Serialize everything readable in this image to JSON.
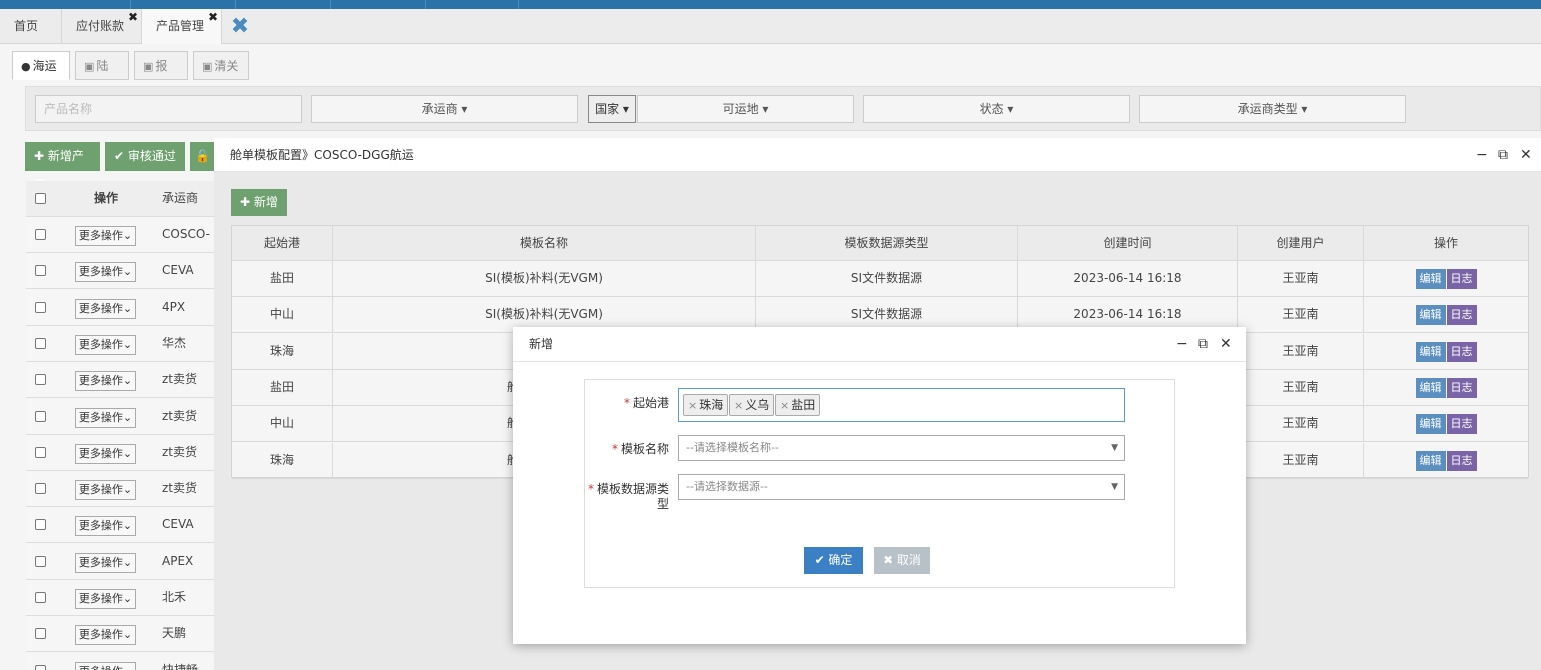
{
  "tabs": [
    {
      "label": "首页",
      "closable": false
    },
    {
      "label": "应付账款",
      "closable": true
    },
    {
      "label": "产品管理",
      "closable": true
    }
  ],
  "subtabs": [
    {
      "label": "海运",
      "icon": "user-icon"
    },
    {
      "label": "陆运",
      "icon": "truck-icon"
    },
    {
      "label": "报关",
      "icon": "truck-icon"
    },
    {
      "label": "清关",
      "icon": "truck-icon"
    }
  ],
  "filters": {
    "product_name_placeholder": "产品名称",
    "carrier": "承运商 ▾",
    "country": "国家 ▾",
    "destination": "可运地 ▾",
    "status": "状态 ▾",
    "carrier_type": "承运商类型 ▾"
  },
  "actions": {
    "add_product": "✚ 新增产品",
    "approve": "✔ 审核通过",
    "unlock": "🔓"
  },
  "left_table": {
    "headers": [
      "操作",
      "承运商"
    ],
    "more_label": "更多操作⌄",
    "carriers": [
      "COSCO-DC",
      "CEVA",
      "4PX",
      "华杰",
      "zt卖货",
      "zt卖货",
      "zt卖货",
      "zt卖货",
      "CEVA",
      "APEX",
      "北禾",
      "天鹏",
      "快捷畅"
    ]
  },
  "dialog1": {
    "title": "舱单模板配置》COSCO-DGG航运",
    "new_label": "✚ 新增",
    "headers": [
      "起始港",
      "模板名称",
      "模板数据源类型",
      "创建时间",
      "创建用户",
      "操作"
    ],
    "edit_label": "编辑",
    "log_label": "日志",
    "rows": [
      {
        "port": "盐田",
        "template": "SI(模板)补料(无VGM)",
        "source": "SI文件数据源",
        "created": "2023-06-14 16:18",
        "user": "王亚南"
      },
      {
        "port": "中山",
        "template": "SI(模板)补料(无VGM)",
        "source": "SI文件数据源",
        "created": "2023-06-14 16:18",
        "user": "王亚南"
      },
      {
        "port": "珠海",
        "template": "SI(模",
        "source": "",
        "created": "",
        "user": "王亚南"
      },
      {
        "port": "盐田",
        "template": "舱单+VGM号",
        "source": "",
        "created": "",
        "user": "王亚南"
      },
      {
        "port": "中山",
        "template": "舱单+VGM号",
        "source": "",
        "created": "",
        "user": "王亚南"
      },
      {
        "port": "珠海",
        "template": "舱单+VGM号",
        "source": "",
        "created": "",
        "user": "王亚南"
      }
    ]
  },
  "dialog2": {
    "title": "新增",
    "port_label": "起始港",
    "ports": [
      "珠海",
      "义乌",
      "盐田"
    ],
    "template_label": "模板名称",
    "template_placeholder": "--请选择模板名称--",
    "source_label": "模板数据源类型",
    "source_placeholder": "--请选择数据源--",
    "ok_label": "✔ 确定",
    "cancel_label": "✖ 取消"
  },
  "window_controls": {
    "minimize": "−",
    "maximize": "⧉",
    "close": "✕"
  }
}
